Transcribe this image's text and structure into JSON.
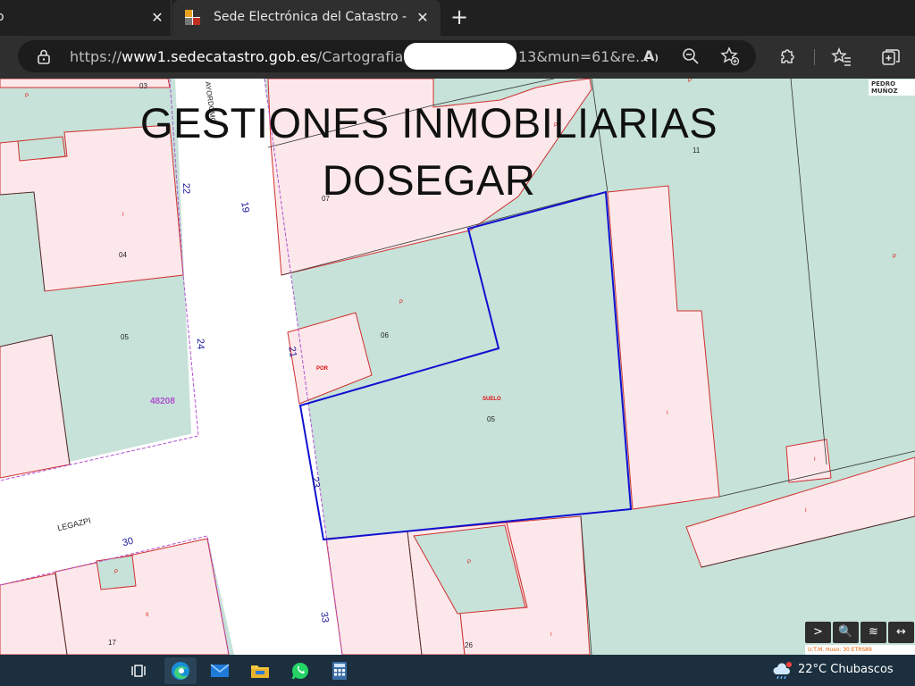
{
  "browser": {
    "prev_tab_title": "o",
    "active_tab_title": "Sede Electrónica del Catastro - Fo",
    "close_symbol": "✕",
    "new_tab_symbol": "+",
    "url_scheme": "https://",
    "url_host": "www1.sedecatastro.gob.es",
    "url_path": "/Cartografia",
    "url_tail": "13&mun=61&re...",
    "read_aloud_label": "A"
  },
  "overlay": {
    "title_line1": "GESTIONES INMOBILIARIAS",
    "title_line2": "DOSEGAR"
  },
  "map": {
    "author_tag": "PEDRO MUÑOZ",
    "streets": {
      "legazpi": "LEGAZPI",
      "top_street": "AYORDOMO"
    },
    "parcel_numbers": {
      "p03": "03",
      "p04": "04",
      "p05_left": "05",
      "p06": "06",
      "p05_main": "05",
      "p07": "07",
      "p11": "11",
      "p17": "17",
      "p26": "26"
    },
    "street_numbers": {
      "n22": "22",
      "n19": "19",
      "n24": "24",
      "n21": "21",
      "n23": "23",
      "n30": "30",
      "n33": "33"
    },
    "red_labels": {
      "por": "POR",
      "suelo": "SUELO",
      "p": "P",
      "i": "I",
      "ii": "II"
    },
    "block_code": "48208",
    "controls": [
      ">",
      "🔍",
      "≋",
      "↔"
    ],
    "utm_text": "U.T.M. Huso: 30 ETRS89",
    "colors": {
      "parcel_fill": "#c6e2d9",
      "building_fill": "#fce8ea",
      "road_fill": "#ffffff",
      "boundary_highlight": "#1010d0",
      "building_border": "#d03030",
      "block_border": "#b050d0"
    }
  },
  "taskbar": {
    "apps": [
      "task-view",
      "edge",
      "mail",
      "file-explorer",
      "whatsapp",
      "calculator"
    ],
    "weather_text": "22°C  Chubascos"
  }
}
